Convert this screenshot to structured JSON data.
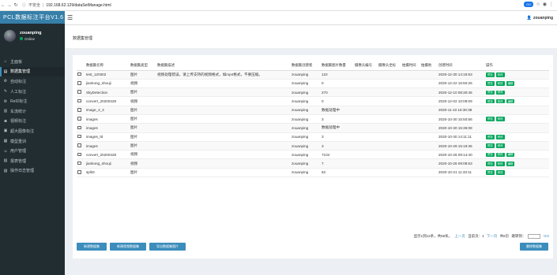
{
  "browser": {
    "back_icon": "arrow-left-icon",
    "forward_icon": "arrow-right-icon",
    "reload_icon": "reload-icon",
    "security_label": "不安全",
    "url": "192.168.62.129/dataSetManage.html",
    "extension_badge": "GO",
    "star_icon": "star-icon",
    "profile_icon": "profile-icon",
    "menu_icon": "more-vertical-icon"
  },
  "app": {
    "title": "PCL数据标注平台V1.6",
    "user_name": "zouanping",
    "user_status": "Online"
  },
  "sidebar": {
    "items": [
      {
        "label": "主面板",
        "icon": "dashboard-icon",
        "active": false
      },
      {
        "label": "数据集管理",
        "icon": "database-icon",
        "active": true
      },
      {
        "label": "自动标注",
        "icon": "gear-icon",
        "active": false
      },
      {
        "label": "人工标注",
        "icon": "edit-icon",
        "active": false
      },
      {
        "label": "ReID标注",
        "icon": "cog-icon",
        "active": false
      },
      {
        "label": "车流统计",
        "icon": "bank-icon",
        "active": false
      },
      {
        "label": "视频标注",
        "icon": "camera-icon",
        "active": false
      },
      {
        "label": "超大图像标注",
        "icon": "image-icon",
        "active": false
      },
      {
        "label": "模型重训",
        "icon": "chart-icon",
        "active": false
      },
      {
        "label": "用户管理",
        "icon": "users-icon",
        "active": false
      },
      {
        "label": "报表管理",
        "icon": "report-icon",
        "active": false
      },
      {
        "label": "操作日志管理",
        "icon": "log-icon",
        "active": false
      }
    ]
  },
  "topbar": {
    "menu_toggle_icon": "hamburger-icon",
    "user_icon": "user-icon",
    "user_name": "zouanping"
  },
  "page": {
    "title": "数据集管理"
  },
  "table": {
    "headers": [
      "",
      "数据集名称",
      "数据集类型",
      "数据集描述",
      "数据集创建者",
      "数据集图片数量",
      "摄像头编号",
      "摄像头坐标",
      "拍摄时间",
      "拍摄地",
      "创建时间",
      "操作"
    ],
    "rows": [
      {
        "name": "test_120302",
        "type": "图片",
        "desc": "视频处理错误，请上传支持的视频格式，如mp4格式，不要压缩。",
        "creator": "zouanping",
        "count": "122",
        "created": "2020-12-30 14:16:53",
        "actions": [
          "预览",
          "修改"
        ]
      },
      {
        "name": "jiankong_shouji",
        "type": "视频",
        "desc": "",
        "creator": "zouanping",
        "count": "0",
        "created": "2020-12-22 15:50:26",
        "actions": [
          "预览",
          "修改",
          "编辑"
        ]
      },
      {
        "name": "SkyDetection",
        "type": "图片",
        "desc": "",
        "creator": "zouanping",
        "count": "270",
        "created": "2020-12-10 08:30:46",
        "actions": [
          "预览",
          "修改"
        ]
      },
      {
        "name": "convert_20200428",
        "type": "视频",
        "desc": "",
        "creator": "zouanping",
        "count": "0",
        "created": "2020-12-02 10:09:09",
        "actions": [
          "预览",
          "修改",
          "编辑"
        ]
      },
      {
        "name": "image_4_3",
        "type": "图片",
        "desc": "",
        "creator": "zouanping",
        "count": "数据处理中",
        "created": "2020-11-10 16:30:38",
        "actions": []
      },
      {
        "name": "images",
        "type": "图片",
        "desc": "",
        "creator": "zouanping",
        "count": "3",
        "created": "2020-10-30 15:50:56",
        "actions": [
          "预览",
          "修改"
        ]
      },
      {
        "name": "images",
        "type": "图片",
        "desc": "",
        "creator": "zouanping",
        "count": "数据处理中",
        "created": "2020-10-30 15:36:08",
        "actions": []
      },
      {
        "name": "images_ttt",
        "type": "图片",
        "desc": "",
        "creator": "zouanping",
        "count": "3",
        "created": "2020-10-30 14:11:11",
        "actions": [
          "预览",
          "修改"
        ]
      },
      {
        "name": "images",
        "type": "图片",
        "desc": "",
        "creator": "zouanping",
        "count": "3",
        "created": "2020-10-29 15:19:36",
        "actions": [
          "预览",
          "修改"
        ]
      },
      {
        "name": "convert_20200428",
        "type": "视频",
        "desc": "",
        "creator": "zouanping",
        "count": "7104",
        "created": "2020-10-26 09:14:40",
        "actions": [
          "预览",
          "修改",
          "编辑"
        ]
      },
      {
        "name": "jiankong_shouji",
        "type": "视频",
        "desc": "",
        "creator": "zouanping",
        "count": "7",
        "created": "2020-10-26 09:08:53",
        "actions": [
          "预览",
          "修改",
          "编辑"
        ]
      },
      {
        "name": "split3",
        "type": "图片",
        "desc": "",
        "creator": "zouanping",
        "count": "62",
        "created": "2020-10-21 11:33:11",
        "actions": [
          "预览",
          "修改"
        ]
      }
    ]
  },
  "pager": {
    "summary": "显示1到12条，共66条。",
    "prev": "上一页",
    "current": "当前页：1",
    "next": "下一页",
    "total_pages": "共6页",
    "jump_label": "跳转到：",
    "go": "GO"
  },
  "buttons": {
    "new_dataset": "新建数据集",
    "new_video_dataset": "新建视频数据集",
    "export_images": "导出数据集图片",
    "delete_dataset": "删除数据集"
  },
  "colors": {
    "sidebar_bg": "#222d32",
    "logo_bg": "#367fa9",
    "primary": "#3c8dbc",
    "success": "#00a65a",
    "page_bg": "#ecf0f5"
  }
}
